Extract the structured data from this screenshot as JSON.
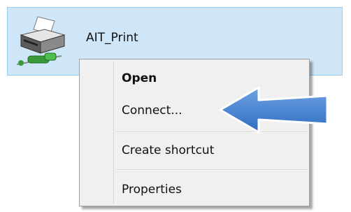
{
  "printer": {
    "name": "AIT_Print",
    "icon": "network-printer-icon"
  },
  "context_menu": {
    "items": [
      {
        "label": "Open",
        "bold": true
      },
      {
        "label": "Connect..."
      },
      {
        "label": "Create shortcut"
      },
      {
        "label": "Properties"
      }
    ]
  },
  "annotation": {
    "icon": "left-arrow-icon",
    "color": "#3f7fcf"
  },
  "colors": {
    "selection_background": "#cfe6f8",
    "selection_border": "#99cdf1",
    "menu_background": "#f0f0f0"
  }
}
